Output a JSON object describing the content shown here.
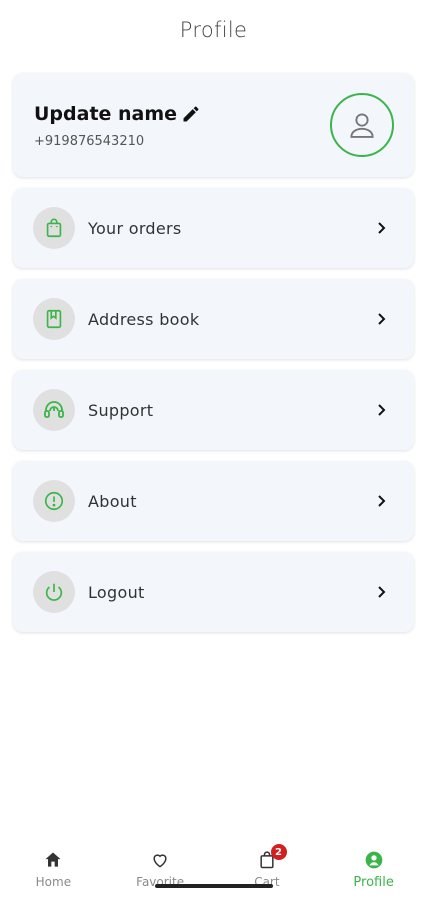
{
  "header": {
    "title": "Profile"
  },
  "profile": {
    "name": "Update name",
    "phone": "+919876543210"
  },
  "menu": [
    {
      "label": "Your orders",
      "icon": "shopping-bag-icon"
    },
    {
      "label": "Address book",
      "icon": "address-book-icon"
    },
    {
      "label": "Support",
      "icon": "headset-icon"
    },
    {
      "label": "About",
      "icon": "info-icon"
    },
    {
      "label": "Logout",
      "icon": "power-icon"
    }
  ],
  "bottom_nav": {
    "items": [
      {
        "label": "Home",
        "icon": "home-icon"
      },
      {
        "label": "Favorite",
        "icon": "heart-icon"
      },
      {
        "label": "Cart",
        "icon": "cart-bag-icon",
        "badge": "2"
      },
      {
        "label": "Profile",
        "icon": "profile-icon",
        "active": true
      }
    ]
  },
  "colors": {
    "accent": "#3bb54a",
    "badge": "#d21f1f",
    "card": "#f3f7fc"
  }
}
